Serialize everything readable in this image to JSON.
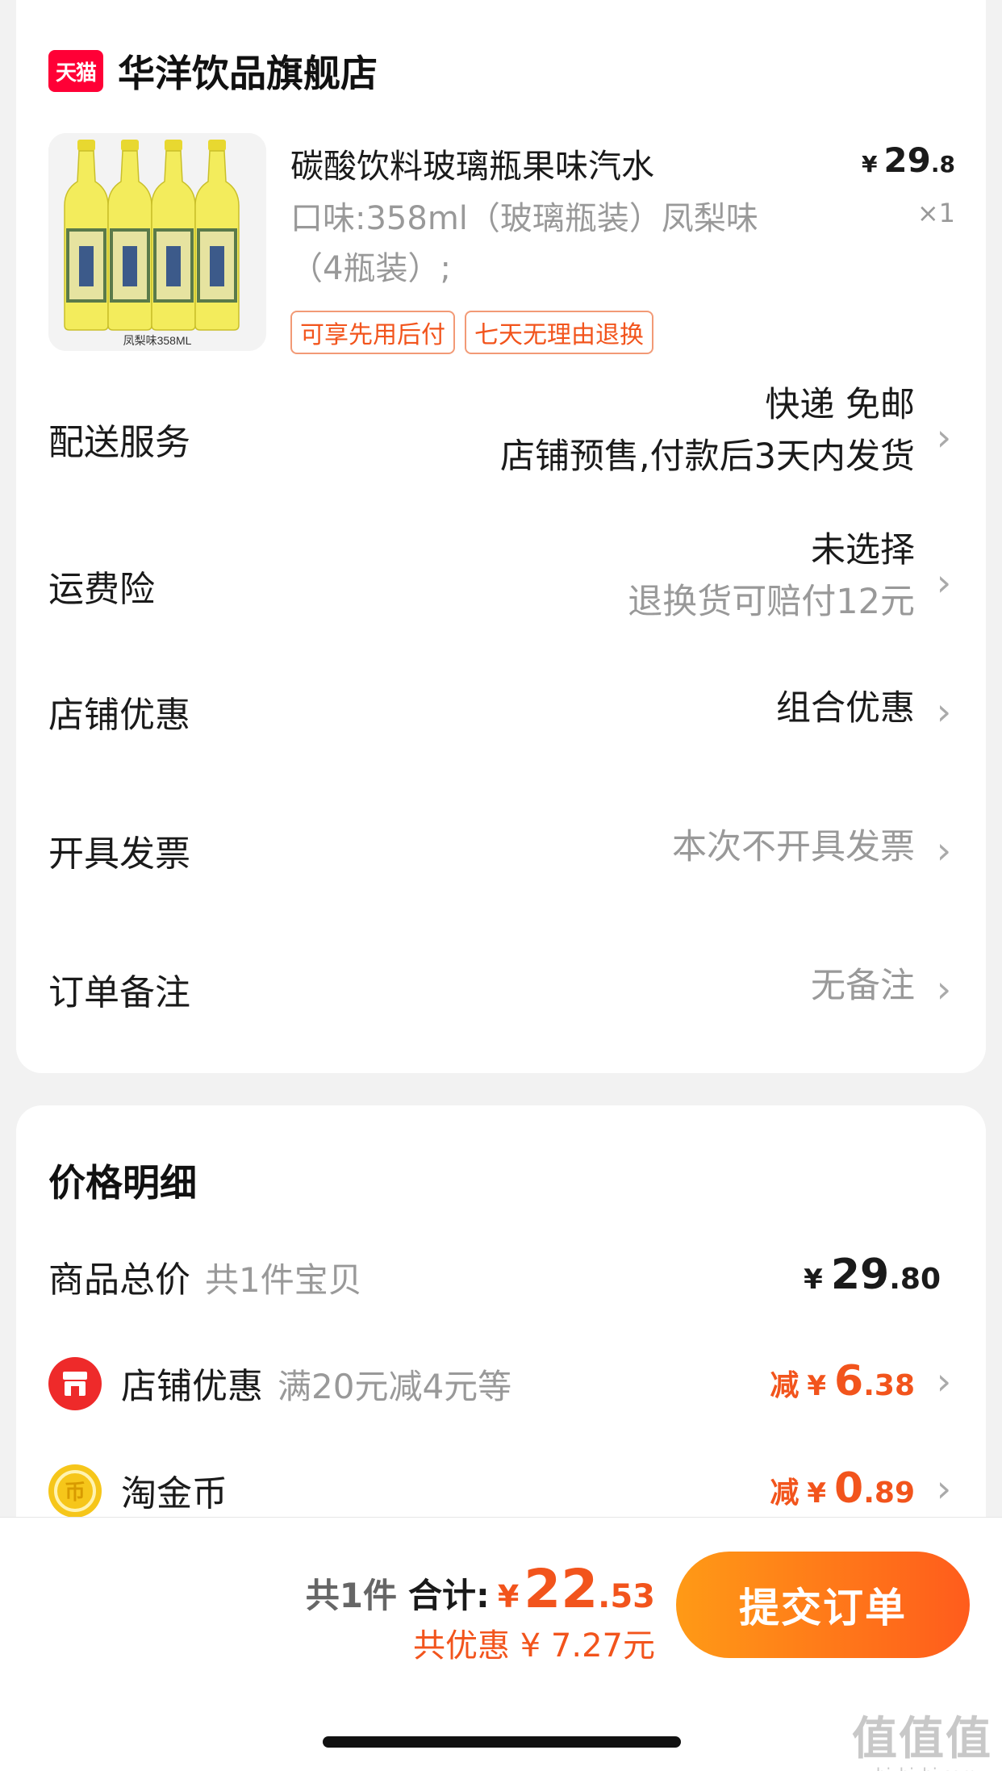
{
  "store": {
    "platform_badge": "天猫",
    "name": "华洋饮品旗舰店"
  },
  "product": {
    "image_caption": "凤梨味358ML",
    "title": "碳酸饮料玻璃瓶果味汽水",
    "spec_line1": "口味:358ml（玻璃瓶装）凤梨味",
    "spec_line2": "（4瓶装）;",
    "price_currency": "¥",
    "price_int": "29",
    "price_dec": ".8",
    "quantity": "×1",
    "tags": [
      "可享先用后付",
      "七天无理由退换"
    ]
  },
  "rows": {
    "delivery": {
      "label": "配送服务",
      "line1": "快递 免邮",
      "line2": "店铺预售,付款后3天内发货"
    },
    "insurance": {
      "label": "运费险",
      "line1": "未选择",
      "line2": "退换货可赔付12元"
    },
    "store_discount": {
      "label": "店铺优惠",
      "value": "组合优惠"
    },
    "invoice": {
      "label": "开具发票",
      "value": "本次不开具发票"
    },
    "note": {
      "label": "订单备注",
      "value": "无备注"
    }
  },
  "price_detail": {
    "title": "价格明细",
    "goods_total": {
      "label": "商品总价",
      "sub": "共1件宝贝",
      "currency": "¥",
      "int": "29",
      "dec": ".80"
    },
    "store_discount": {
      "label": "店铺优惠",
      "sub": "满20元减4元等",
      "prefix": "减",
      "currency": "¥",
      "int": "6",
      "dec": ".38"
    },
    "coins": {
      "label": "淘金币",
      "prefix": "减",
      "currency": "¥",
      "int": "0",
      "dec": ".89"
    }
  },
  "bottom": {
    "count": "共1件",
    "total_label": "合计:",
    "currency": "¥",
    "total_int": "22",
    "total_dec": ".53",
    "saving": "共优惠 ¥ 7.27元",
    "submit": "提交订单"
  },
  "watermark": {
    "main": "值值值",
    "sub": "zhizhizhi.com"
  },
  "colors": {
    "accent": "#f2541c",
    "tmall_red": "#ff0036",
    "button_start": "#ff9a16",
    "button_end": "#ff5c1c"
  }
}
